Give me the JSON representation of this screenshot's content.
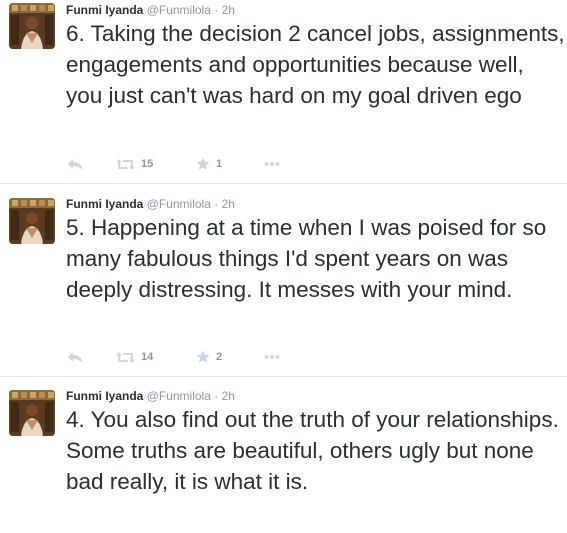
{
  "colors": {
    "text": "#292f33",
    "muted": "#8899a6",
    "icon": "#ccd6dd",
    "divider": "#e1e8ed"
  },
  "tweets": [
    {
      "fullname": "Funmi Iyanda",
      "username": "@Funmilola",
      "dot": "·",
      "time": "2h",
      "text": "6. Taking the decision 2 cancel jobs, assignments, engagements and opportunities because well, you just can't was hard on my goal driven ego",
      "retweets": "15",
      "favorites": "1",
      "icons": [
        "reply-icon",
        "retweet-icon",
        "star-icon",
        "more-icon"
      ]
    },
    {
      "fullname": "Funmi Iyanda",
      "username": "@Funmilola",
      "dot": "·",
      "time": "2h",
      "text": "5. Happening at a time when I was poised for so many fabulous things I'd spent years on was deeply distressing. It messes with your mind.",
      "retweets": "14",
      "favorites": "2",
      "icons": [
        "reply-icon",
        "retweet-icon",
        "star-icon",
        "more-icon"
      ]
    },
    {
      "fullname": "Funmi Iyanda",
      "username": "@Funmilola",
      "dot": "·",
      "time": "2h",
      "text": "4. You also find out the truth of your relationships. Some truths are beautiful, others ugly but none bad really, it is what it is."
    }
  ]
}
